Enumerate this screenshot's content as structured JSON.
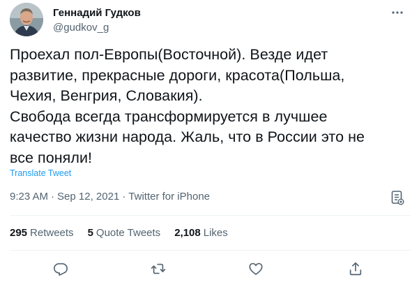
{
  "author": {
    "name": "Геннадий Гудков",
    "handle": "@gudkov_g"
  },
  "tweet": {
    "lines": [
      "Проехал пол-Европы(Восточной). Везде идет",
      "развитие, прекрасные дороги, красота(Польша,",
      "Чехия, Венгрия, Словакия).",
      "Свобода всегда трансформируется в лучшее",
      "качество жизни народа. Жаль, что в России это не",
      "все поняли!"
    ],
    "translate_label": "Translate Tweet",
    "time": "9:23 AM",
    "date": "Sep 12, 2021",
    "source": "Twitter for iPhone",
    "separator": "·"
  },
  "stats": {
    "retweets_count": "295",
    "retweets_label": "Retweets",
    "quotes_count": "5",
    "quotes_label": "Quote Tweets",
    "likes_count": "2,108",
    "likes_label": "Likes"
  },
  "icons": {
    "more": "more-horizontal-icon",
    "analytics": "analytics-icon",
    "reply": "reply-icon",
    "retweet": "retweet-icon",
    "like": "heart-icon",
    "share": "share-icon"
  },
  "colors": {
    "link": "#1d9bf0",
    "text_primary": "#0f1419",
    "text_secondary": "#536471",
    "divider": "#eff3f4"
  }
}
